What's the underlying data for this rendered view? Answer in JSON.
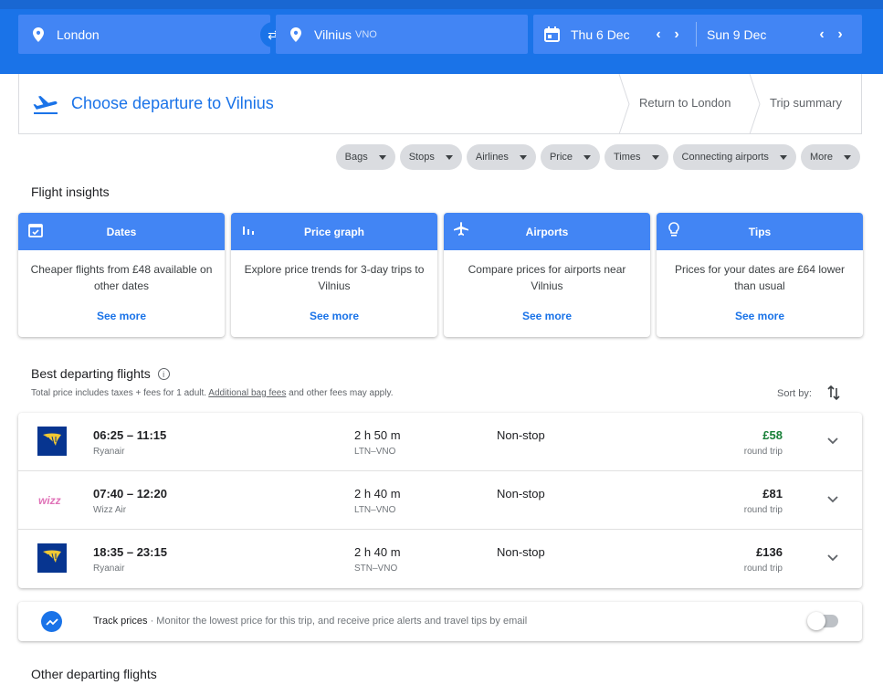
{
  "search": {
    "origin": "London",
    "destination": "Vilnius",
    "destination_code": "VNO",
    "depart_date": "Thu 6 Dec",
    "return_date": "Sun 9 Dec"
  },
  "steps": {
    "current": "Choose departure to Vilnius",
    "return": "Return to London",
    "summary": "Trip summary"
  },
  "filters": [
    "Bags",
    "Stops",
    "Airlines",
    "Price",
    "Times",
    "Connecting airports",
    "More"
  ],
  "insights": {
    "title": "Flight insights",
    "cards": [
      {
        "title": "Dates",
        "icon": "calendar-check-icon",
        "body": "Cheaper flights from £48 available on other dates",
        "link": "See more"
      },
      {
        "title": "Price graph",
        "icon": "bar-graph-icon",
        "body": "Explore price trends for 3-day trips to Vilnius",
        "link": "See more"
      },
      {
        "title": "Airports",
        "icon": "airplane-icon",
        "body": "Compare prices for airports near Vilnius",
        "link": "See more"
      },
      {
        "title": "Tips",
        "icon": "lightbulb-icon",
        "body": "Prices for your dates are £64 lower than usual",
        "link": "See more"
      }
    ]
  },
  "best": {
    "title": "Best departing flights",
    "note_prefix": "Total price includes taxes + fees for 1 adult.",
    "note_link": "Additional bag fees",
    "note_suffix": "and other fees may apply.",
    "sort_label": "Sort by:"
  },
  "flights": [
    {
      "times": "06:25 – 11:15",
      "airline": "Ryanair",
      "duration": "2 h 50 m",
      "route": "LTN–VNO",
      "stops": "Non-stop",
      "price": "£58",
      "price_type": "round trip"
    },
    {
      "times": "07:40 – 12:20",
      "airline": "Wizz Air",
      "duration": "2 h 40 m",
      "route": "LTN–VNO",
      "stops": "Non-stop",
      "price": "£81",
      "price_type": "round trip"
    },
    {
      "times": "18:35 – 23:15",
      "airline": "Ryanair",
      "duration": "2 h 40 m",
      "route": "STN–VNO",
      "stops": "Non-stop",
      "price": "£136",
      "price_type": "round trip"
    }
  ],
  "track": {
    "label": "Track prices",
    "desc": "· Monitor the lowest price for this trip, and receive price alerts and travel tips by email"
  },
  "other": {
    "title": "Other departing flights"
  },
  "colors": {
    "accent": "#1a73e8",
    "field": "#4285f4",
    "cheap": "#188038"
  }
}
